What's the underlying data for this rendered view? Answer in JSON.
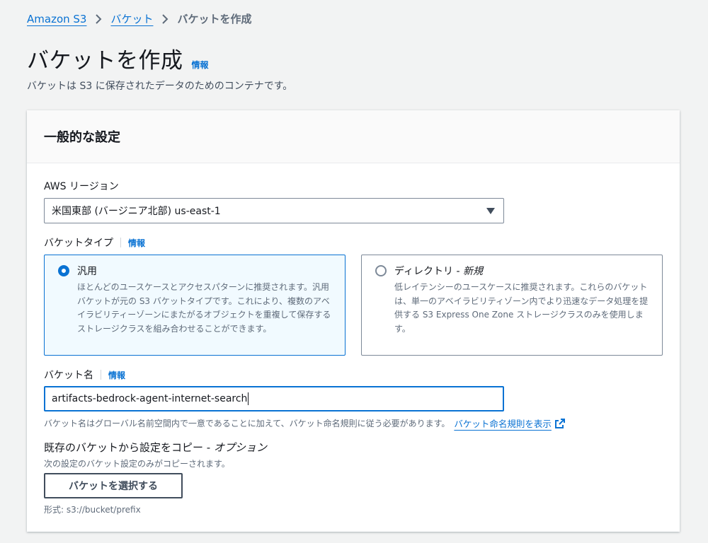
{
  "breadcrumb": {
    "items": [
      "Amazon S3",
      "バケット"
    ],
    "current": "バケットを作成"
  },
  "header": {
    "title": "バケットを作成",
    "info": "情報",
    "description": "バケットは S3 に保存されたデータのためのコンテナです。"
  },
  "general": {
    "title": "一般的な設定",
    "region_label": "AWS リージョン",
    "region_value": "米国東部 (バージニア北部) us-east-1",
    "bucket_type_label": "バケットタイプ",
    "bucket_type_info": "情報",
    "tiles": [
      {
        "title": "汎用",
        "title_suffix": "",
        "selected": true,
        "description": "ほとんどのユースケースとアクセスパターンに推奨されます。汎用バケットが元の S3 バケットタイプです。これにより、複数のアベイラビリティーゾーンにまたがるオブジェクトを重複して保存するストレージクラスを組み合わせることができます。"
      },
      {
        "title": "ディレクトリ - ",
        "title_suffix": "新規",
        "selected": false,
        "description": "低レイテンシーのユースケースに推奨されます。これらのバケットは、単一のアベイラビリティゾーン内でより迅速なデータ処理を提供する S3 Express One Zone ストレージクラスのみを使用します。"
      }
    ],
    "bucket_name_label": "バケット名",
    "bucket_name_info": "情報",
    "bucket_name_value": "artifacts-bedrock-agent-internet-search",
    "bucket_name_hint": "バケット名はグローバル名前空間内で一意であることに加えて、バケット命名規則に従う必要があります。",
    "naming_rules_link": "バケット命名規則を表示",
    "copy_title": "既存のバケットから設定をコピー - ",
    "copy_title_suffix": "オプション",
    "copy_desc": "次の設定のバケット設定のみがコピーされます。",
    "choose_button": "バケットを選択する",
    "format_hint": "形式: s3://bucket/prefix"
  },
  "colors": {
    "link": "#0972d3",
    "selected_tile_bg": "#f1faff",
    "page_bg": "#f2f3f3"
  }
}
